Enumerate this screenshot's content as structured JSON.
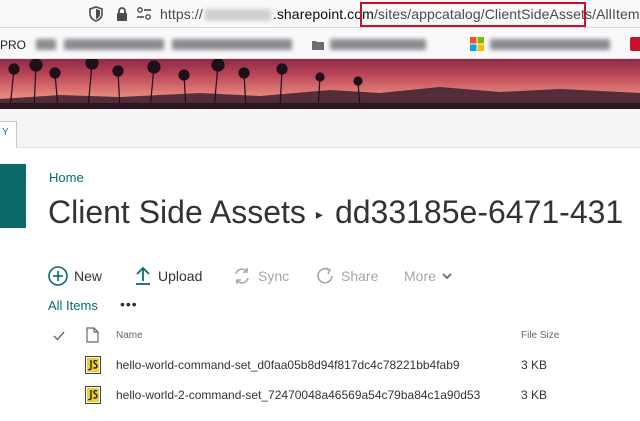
{
  "browser": {
    "url_prefix": "https://",
    "url_domain": ".sharepoint.com",
    "url_path": "/sites/appcatalog/ClientSideAssets/AllItems.as"
  },
  "bookmarks": {
    "first_label": "PRO"
  },
  "ribbon": {
    "tab_label": "Y"
  },
  "breadcrumb": {
    "home": "Home"
  },
  "page": {
    "library": "Client Side Assets",
    "folder": "dd33185e-6471-431"
  },
  "commands": {
    "new": "New",
    "upload": "Upload",
    "sync": "Sync",
    "share": "Share",
    "more": "More"
  },
  "view": {
    "current": "All Items",
    "more": "•••"
  },
  "list": {
    "columns": {
      "name": "Name",
      "file_size": "File Size"
    },
    "rows": [
      {
        "name": "hello-world-command-set_d0faa05b8d94f817dc4c78221bb4fab9",
        "size": "3 KB",
        "icon": "js-file-icon"
      },
      {
        "name": "hello-world-2-command-set_72470048a46569a54c79ba84c1a90d53",
        "size": "3 KB",
        "icon": "js-file-icon"
      }
    ]
  },
  "colors": {
    "theme": "#0b6a6a",
    "highlight": "#c8102e"
  }
}
